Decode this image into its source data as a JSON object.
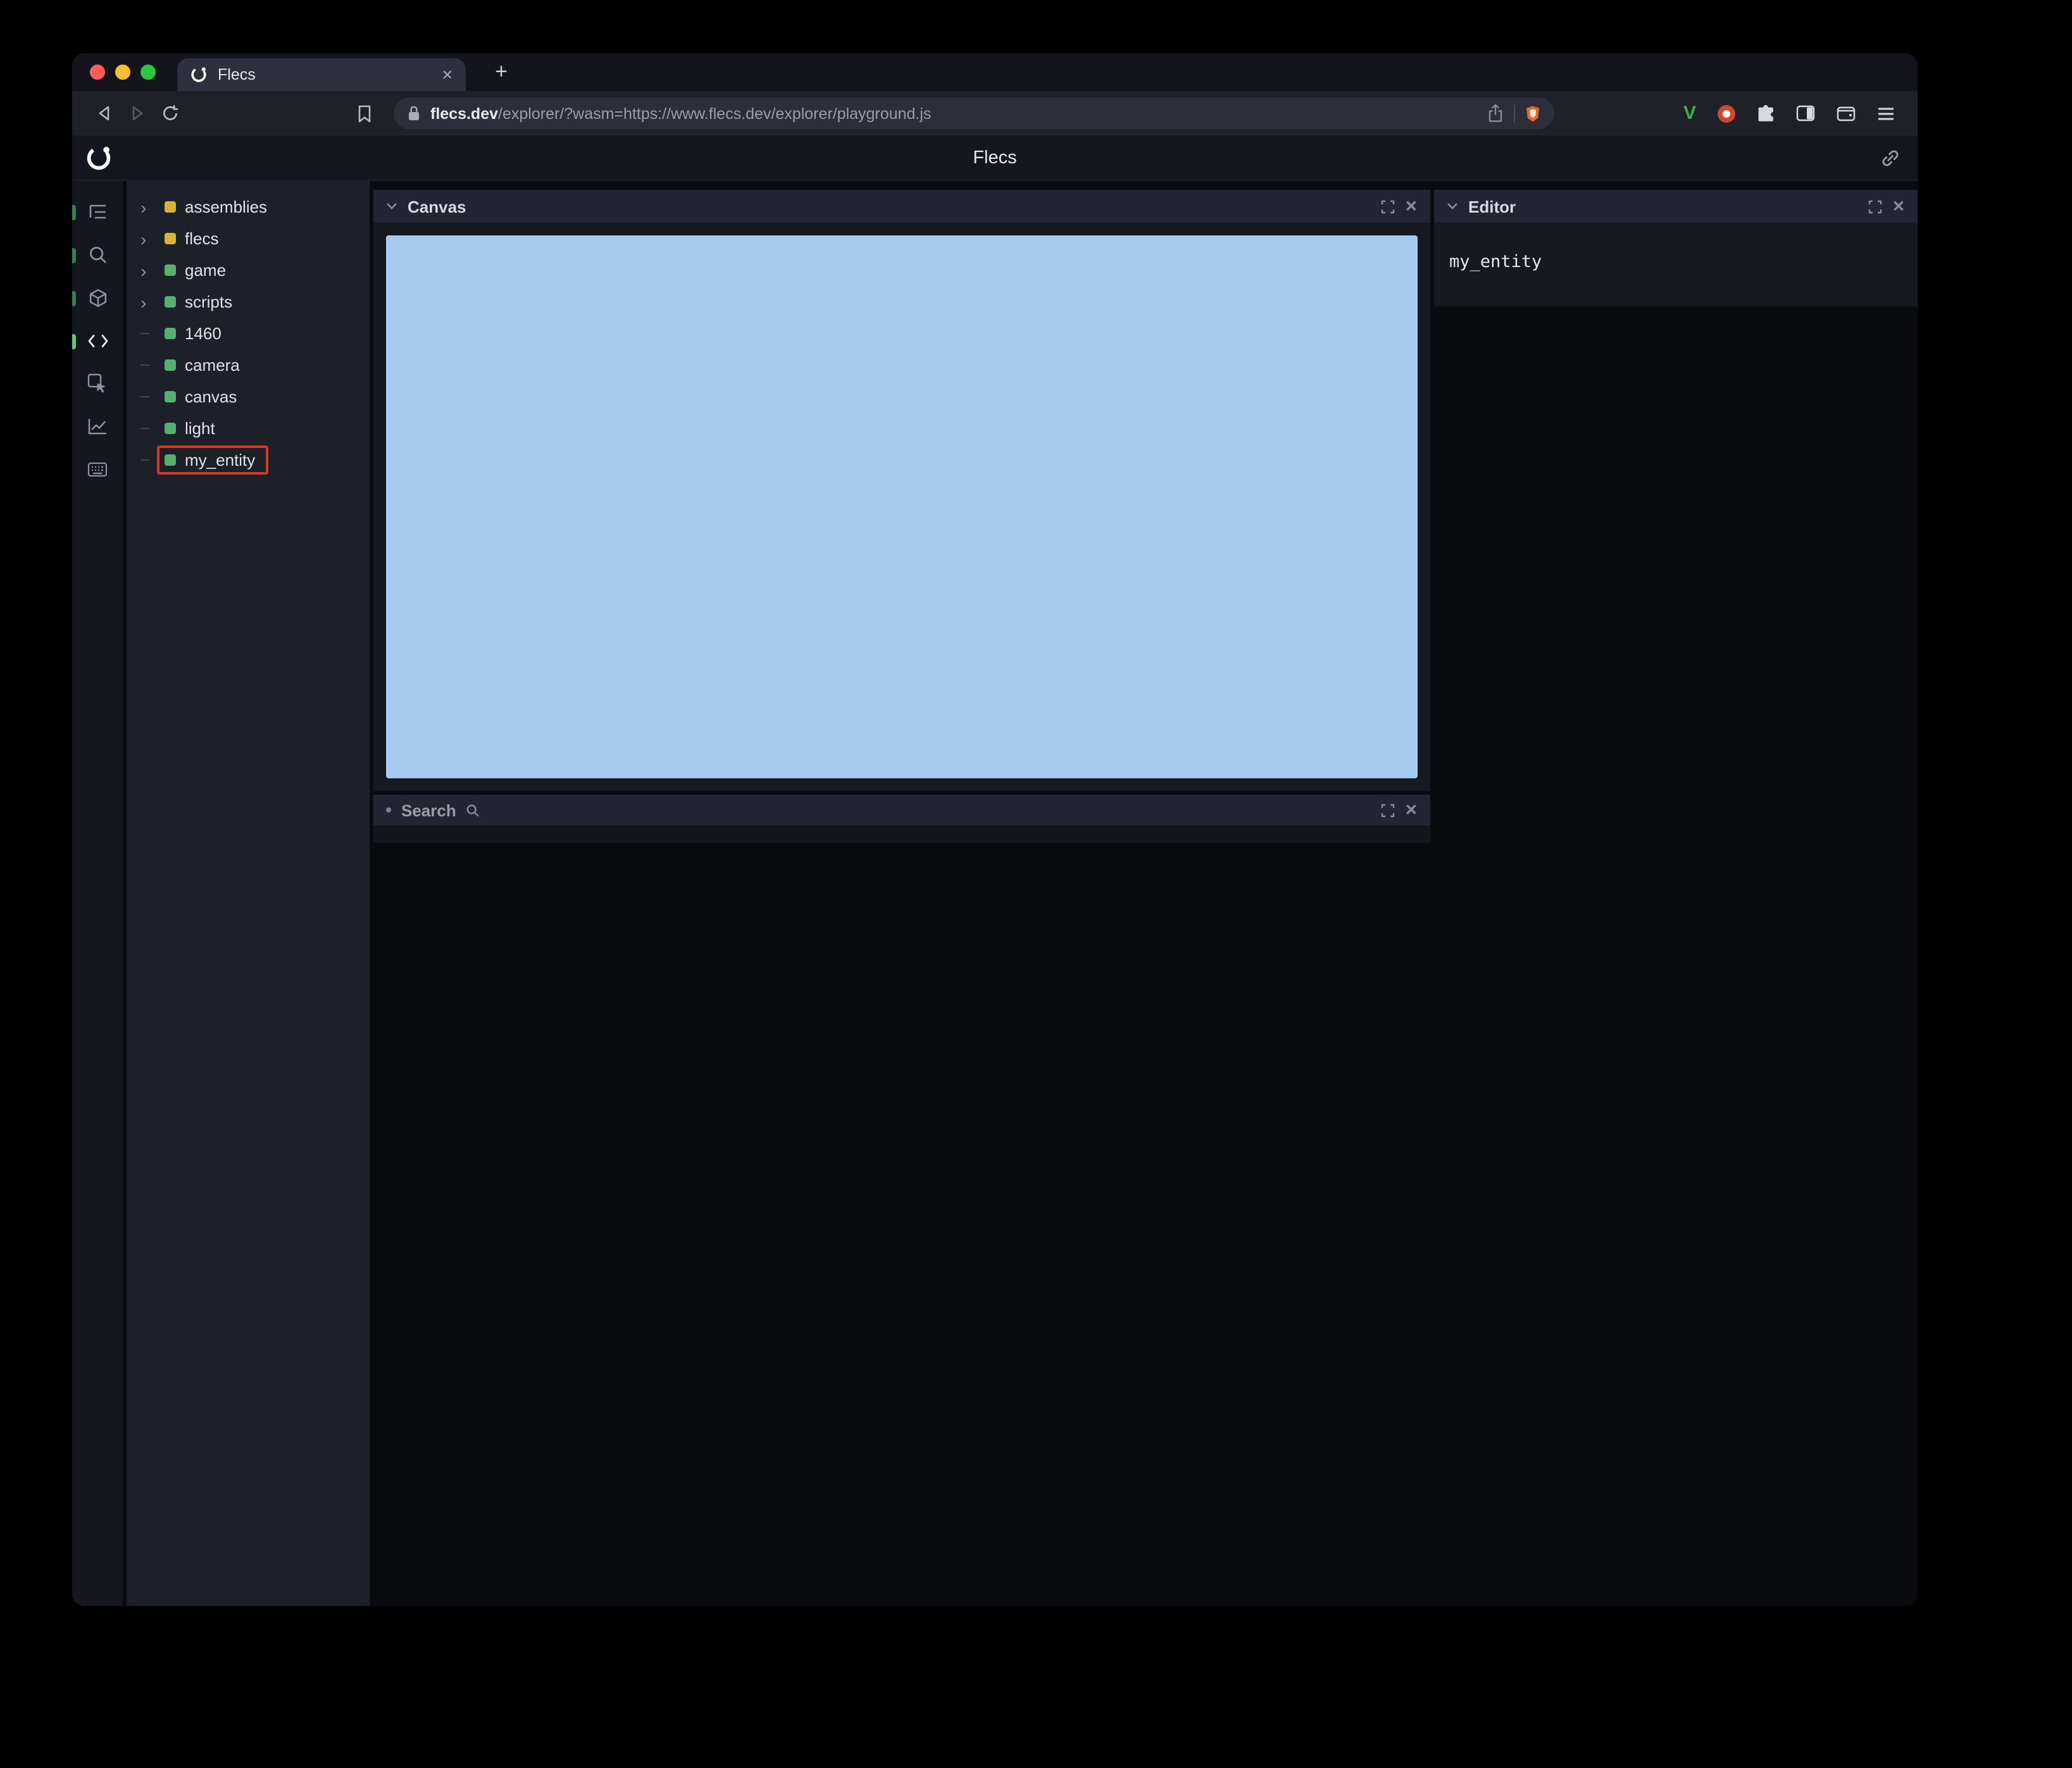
{
  "colors": {
    "green": "#55b16c",
    "yellow": "#d9b23b",
    "annotation": "#d03b22",
    "canvas_blue": "#a5cbf0",
    "brave_orange": "#e8642c",
    "v_green": "#3fae4a",
    "ext_red": "#d1452e",
    "traffic_lights": [
      "#ff5f57",
      "#febc2e",
      "#28c840"
    ]
  },
  "glyphs": {
    "close": "✕",
    "new_tab": "+",
    "expand_arrow": "›"
  },
  "browser": {
    "tab_title": "Flecs",
    "url_domain": "flecs.dev",
    "url_path": "/explorer/?wasm=https://www.flecs.dev/explorer/playground.js"
  },
  "app": {
    "header_title": "Flecs",
    "tree": {
      "items": [
        {
          "label": "assemblies",
          "color": "yellow",
          "expandable": true,
          "highlighted": false
        },
        {
          "label": "flecs",
          "color": "yellow",
          "expandable": true,
          "highlighted": false
        },
        {
          "label": "game",
          "color": "green",
          "expandable": true,
          "highlighted": false
        },
        {
          "label": "scripts",
          "color": "green",
          "expandable": true,
          "highlighted": false
        },
        {
          "label": "1460",
          "color": "green",
          "expandable": false,
          "highlighted": false
        },
        {
          "label": "camera",
          "color": "green",
          "expandable": false,
          "highlighted": false
        },
        {
          "label": "canvas",
          "color": "green",
          "expandable": false,
          "highlighted": false
        },
        {
          "label": "light",
          "color": "green",
          "expandable": false,
          "highlighted": false
        },
        {
          "label": "my_entity",
          "color": "green",
          "expandable": false,
          "highlighted": true
        }
      ]
    },
    "panels": {
      "canvas": {
        "title": "Canvas"
      },
      "search": {
        "title": "Search"
      },
      "editor": {
        "title": "Editor",
        "content": "my_entity"
      }
    }
  }
}
